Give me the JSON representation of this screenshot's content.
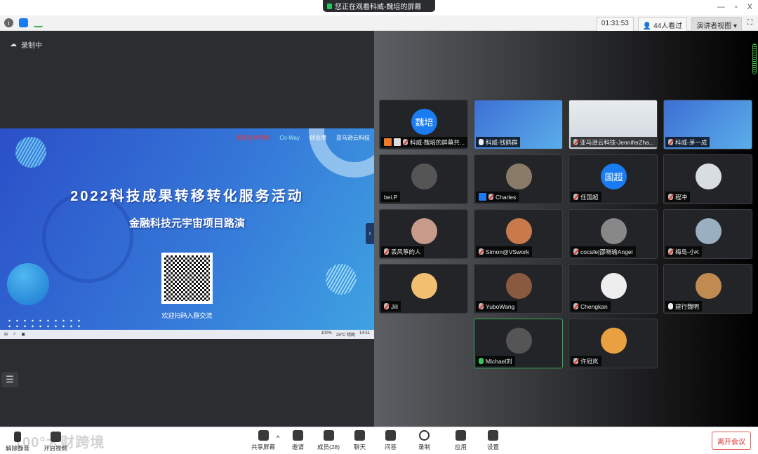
{
  "titlebar": {
    "share_notice": "您正在观看科威-魏培的屏幕",
    "minimize": "—",
    "restore": "▫",
    "close": "X"
  },
  "infobar": {
    "timer": "01:31:53",
    "viewers": "44人看过",
    "view_mode": "演讲者视图",
    "view_mode_caret": "▾"
  },
  "recording": {
    "label": "录制中"
  },
  "slide": {
    "logos": [
      "国家技术转移",
      "Co-Way",
      "创业港",
      "亚马逊云科技"
    ],
    "title": "2022科技成果转移转化服务活动",
    "subtitle": "金融科技元宇宙项目路演",
    "caption": "欢迎扫码入群交流",
    "taskbar": {
      "battery": "100%",
      "weather": "28°C 晴朗",
      "clock": "14:51"
    }
  },
  "participants": [
    {
      "name": "科威-魏培的屏幕共...",
      "mic": "muted",
      "avatar_text": "魏培",
      "avatar_color": "#1a7cf0",
      "badges": [
        "host",
        "share"
      ]
    },
    {
      "name": "科威-钱鹤群",
      "mic": "on",
      "kind": "video"
    },
    {
      "name": "亚马逊云科技-JenniferZha...",
      "mic": "muted",
      "kind": "room"
    },
    {
      "name": "科威-茅一成",
      "mic": "muted",
      "kind": "video"
    },
    {
      "name": "bei.P",
      "mic": "none",
      "avatar_color": "#555"
    },
    {
      "name": "Charles",
      "mic": "muted",
      "avatar_color": "#8a7a68",
      "badges": [
        "cohost"
      ]
    },
    {
      "name": "任国超",
      "mic": "muted",
      "avatar_text": "国超",
      "avatar_color": "#1a7cf0"
    },
    {
      "name": "程冲",
      "mic": "muted",
      "avatar_color": "#d8dde2"
    },
    {
      "name": "丢风筝的人",
      "mic": "muted",
      "avatar_color": "#c89a8a"
    },
    {
      "name": "Simon@VSwork",
      "mic": "muted",
      "avatar_color": "#c87a4a"
    },
    {
      "name": "cocafe|邵晓瑜Angel",
      "mic": "muted",
      "avatar_color": "#888"
    },
    {
      "name": "梅岛-小K",
      "mic": "muted",
      "avatar_color": "#9ab0c0"
    },
    {
      "name": "Jill",
      "mic": "muted",
      "avatar_color": "#f0c070"
    },
    {
      "name": "YuboWang",
      "mic": "muted",
      "avatar_color": "#8a5a40"
    },
    {
      "name": "Chengkan",
      "mic": "muted",
      "avatar_color": "#eee"
    },
    {
      "name": "建行魏明",
      "mic": "on",
      "avatar_color": "#c08a50"
    },
    {
      "name": "Michael刘",
      "mic": "speaking",
      "avatar_color": "#555",
      "active": true
    },
    {
      "name": "许冠岚",
      "mic": "muted",
      "avatar_color": "#e8a040"
    }
  ],
  "toolbar": {
    "watermark": "100°大财跨境",
    "mute": "解除静音",
    "video": "开启视频",
    "items": [
      {
        "label": "共享屏幕",
        "icon": "share-screen-icon"
      },
      {
        "label": "邀请",
        "icon": "invite-icon"
      },
      {
        "label": "成员(28)",
        "icon": "members-icon"
      },
      {
        "label": "聊天",
        "icon": "chat-icon"
      },
      {
        "label": "问答",
        "icon": "qa-icon"
      },
      {
        "label": "录制",
        "icon": "record-icon"
      },
      {
        "label": "应用",
        "icon": "apps-icon"
      },
      {
        "label": "设置",
        "icon": "settings-icon"
      }
    ],
    "share_caret": "^",
    "leave": "离开会议"
  },
  "colors": {
    "accent": "#1a7cf0",
    "speaking": "#2fb155",
    "leave": "#d33333"
  }
}
